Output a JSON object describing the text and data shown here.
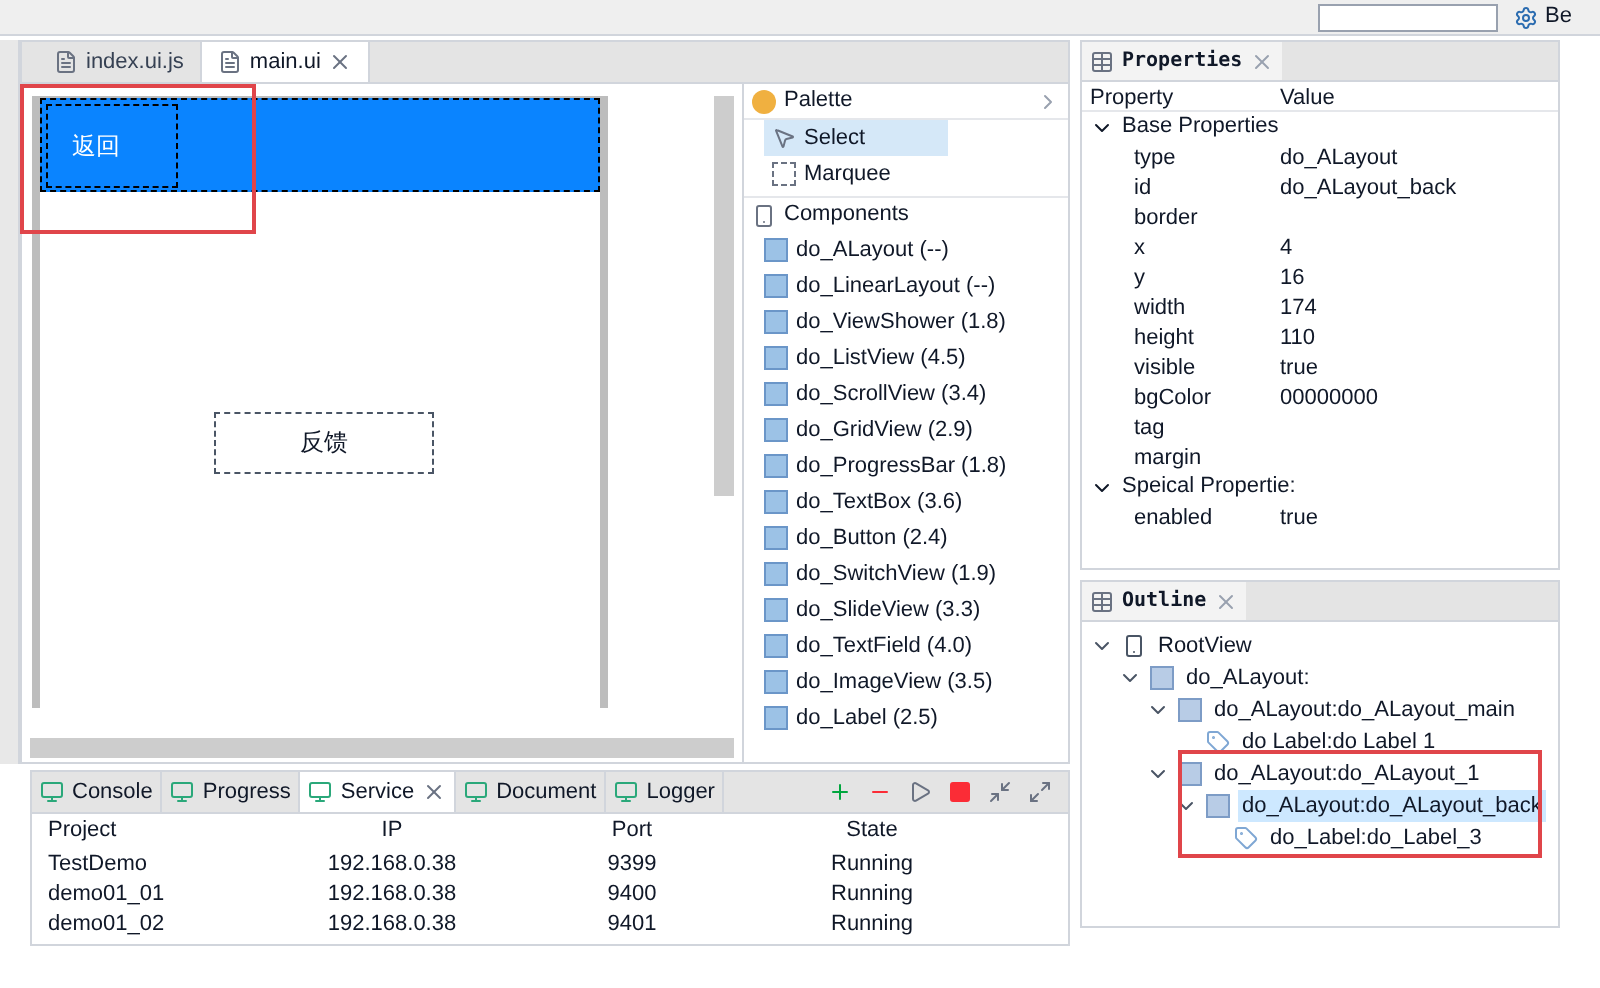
{
  "toolbar": {
    "corner_text": "Be"
  },
  "editor": {
    "tabs": [
      {
        "label": "index.ui.js",
        "selected": false
      },
      {
        "label": "main.ui",
        "selected": true
      }
    ],
    "canvas": {
      "header_label": "返回",
      "button_label": "反馈"
    }
  },
  "palette": {
    "title": "Palette",
    "tools": [
      {
        "label": "Select",
        "selected": true,
        "kind": "select"
      },
      {
        "label": "Marquee",
        "selected": false,
        "kind": "marquee"
      }
    ],
    "components_title": "Components",
    "components": [
      "do_ALayout (--)",
      "do_LinearLayout (--)",
      "do_ViewShower (1.8)",
      "do_ListView (4.5)",
      "do_ScrollView (3.4)",
      "do_GridView (2.9)",
      "do_ProgressBar (1.8)",
      "do_TextBox (3.6)",
      "do_Button (2.4)",
      "do_SwitchView (1.9)",
      "do_SlideView (3.3)",
      "do_TextField (4.0)",
      "do_ImageView (3.5)",
      "do_Label (2.5)"
    ]
  },
  "bottom_panel": {
    "tabs": [
      {
        "label": "Console",
        "selected": false
      },
      {
        "label": "Progress",
        "selected": false
      },
      {
        "label": "Service",
        "selected": true
      },
      {
        "label": "Document",
        "selected": false
      },
      {
        "label": "Logger",
        "selected": false
      }
    ],
    "table": {
      "columns": [
        "Project",
        "IP",
        "Port",
        "State"
      ],
      "rows": [
        [
          "TestDemo",
          "192.168.0.38",
          "9399",
          "Running"
        ],
        [
          "demo01_01",
          "192.168.0.38",
          "9400",
          "Running"
        ],
        [
          "demo01_02",
          "192.168.0.38",
          "9401",
          "Running"
        ]
      ]
    }
  },
  "properties": {
    "title": "Properties",
    "columns": [
      "Property",
      "Value"
    ],
    "groups": [
      {
        "label": "Base Properties",
        "expanded": true,
        "rows": [
          {
            "name": "type",
            "value": "do_ALayout"
          },
          {
            "name": "id",
            "value": "do_ALayout_back"
          },
          {
            "name": "border",
            "value": ""
          },
          {
            "name": "x",
            "value": "4"
          },
          {
            "name": "y",
            "value": "16"
          },
          {
            "name": "width",
            "value": "174"
          },
          {
            "name": "height",
            "value": "110"
          },
          {
            "name": "visible",
            "value": "true"
          },
          {
            "name": "bgColor",
            "value": "00000000"
          },
          {
            "name": "tag",
            "value": ""
          },
          {
            "name": "margin",
            "value": ""
          }
        ]
      },
      {
        "label": "Speical Propertie:",
        "expanded": true,
        "rows": [
          {
            "name": "enabled",
            "value": "true"
          }
        ]
      }
    ]
  },
  "outline": {
    "title": "Outline",
    "tree": [
      {
        "label": "RootView",
        "kind": "device",
        "expanded": true,
        "selected": false,
        "children": [
          {
            "label": "do_ALayout:",
            "kind": "layout",
            "expanded": true,
            "selected": false,
            "children": [
              {
                "label": "do_ALayout:do_ALayout_main",
                "kind": "layout",
                "expanded": true,
                "selected": false,
                "children": [
                  {
                    "label": "do Label:do Label 1",
                    "kind": "label",
                    "selected": false
                  }
                ]
              },
              {
                "label": "do_ALayout:do_ALayout_1",
                "kind": "layout",
                "expanded": true,
                "selected": false,
                "children": [
                  {
                    "label": "do_ALayout:do_ALayout_back",
                    "kind": "layout",
                    "expanded": true,
                    "selected": true,
                    "children": [
                      {
                        "label": "do_Label:do_Label_3",
                        "kind": "label",
                        "selected": false
                      }
                    ]
                  }
                ]
              }
            ]
          }
        ]
      }
    ]
  }
}
